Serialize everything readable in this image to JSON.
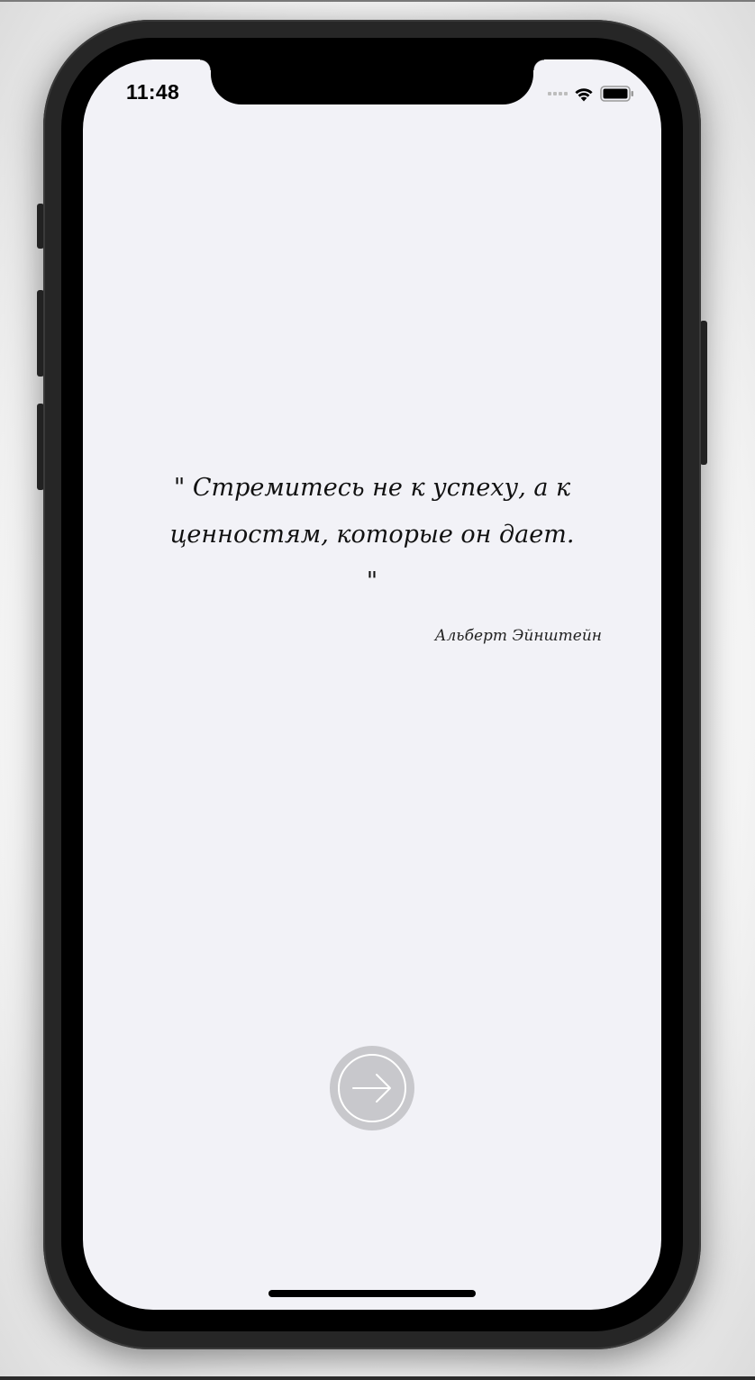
{
  "status_bar": {
    "time": "11:48",
    "wifi_icon": "wifi-icon",
    "battery_icon": "battery-icon",
    "signal_icon": "signal-dots-icon"
  },
  "content": {
    "quote": "\" Стремитесь не к успеху, а к ценностям, которые он дает. \"",
    "author": "Альберт Эйнштейн"
  },
  "next_button": {
    "icon": "arrow-right-icon"
  },
  "colors": {
    "screen_background": "#f2f2f7",
    "button_background": "#c8c8cc",
    "text": "#111111"
  }
}
